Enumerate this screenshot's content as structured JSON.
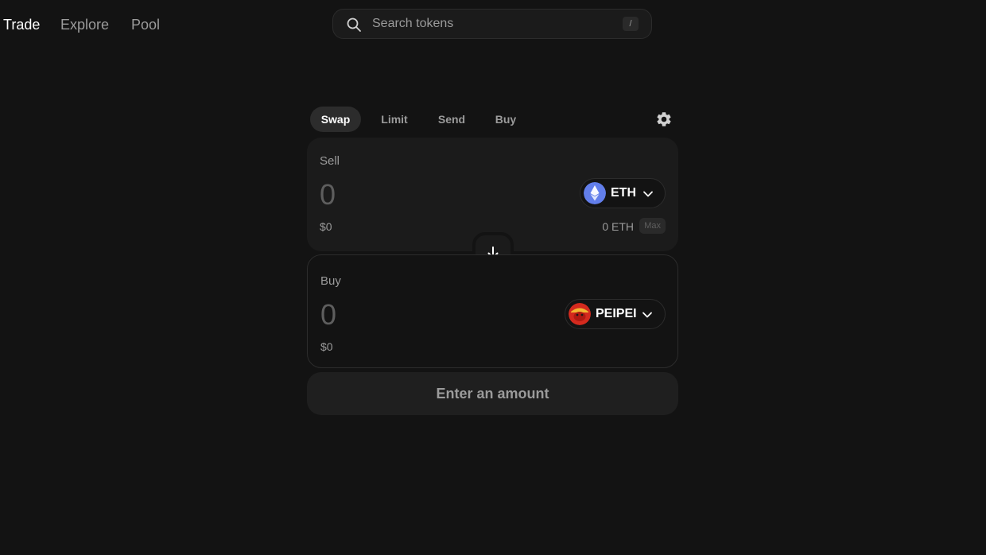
{
  "nav": {
    "links": [
      {
        "label": "Trade",
        "active": true
      },
      {
        "label": "Explore",
        "active": false
      },
      {
        "label": "Pool",
        "active": false
      }
    ]
  },
  "search": {
    "placeholder": "Search tokens",
    "shortcut": "/",
    "icon": "search-icon"
  },
  "swap": {
    "tabs": [
      {
        "label": "Swap",
        "active": true
      },
      {
        "label": "Limit",
        "active": false
      },
      {
        "label": "Send",
        "active": false
      },
      {
        "label": "Buy",
        "active": false
      }
    ],
    "settings_icon": "gear-icon",
    "sell": {
      "label": "Sell",
      "amount": "0",
      "usd": "$0",
      "token": {
        "symbol": "ETH",
        "color": "#627EEA"
      },
      "balance": "0 ETH",
      "max_label": "Max"
    },
    "switch_icon": "arrow-down-icon",
    "buy": {
      "label": "Buy",
      "amount": "0",
      "usd": "$0",
      "token": {
        "symbol": "PEIPEI",
        "color": "#D42A1E"
      }
    },
    "cta_label": "Enter an amount"
  },
  "colors": {
    "background": "#131313",
    "surface": "#1b1b1b",
    "border": "#2c2c2c",
    "text_secondary": "#9b9b9b",
    "text_muted": "#5e5e5e"
  }
}
